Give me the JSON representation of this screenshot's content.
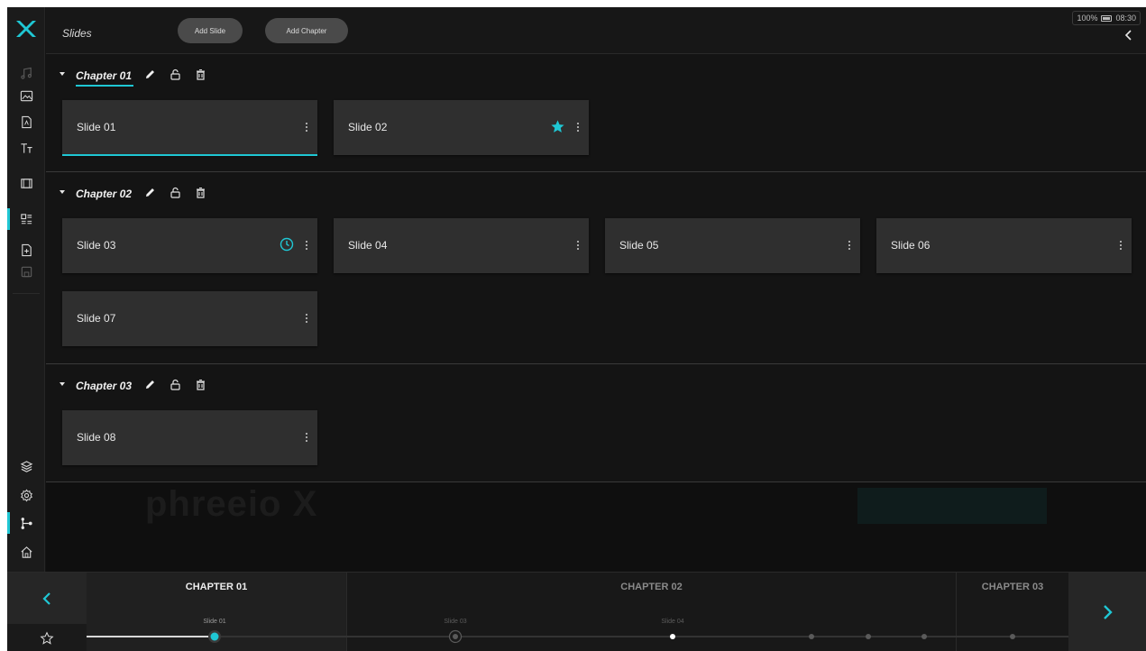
{
  "header": {
    "title": "Slides",
    "add_slide": "Add Slide",
    "add_chapter": "Add Chapter",
    "battery": "100%",
    "time": "08:30"
  },
  "rail": {
    "top_icons": [
      "music-icon",
      "image-icon",
      "pdf-icon",
      "text-icon",
      "video-icon",
      "slides-icon",
      "add-file-icon",
      "save-icon"
    ],
    "bottom_icons": [
      "layers-icon",
      "settings-icon",
      "flow-icon",
      "home-icon"
    ],
    "active": [
      "slides-icon",
      "flow-icon"
    ]
  },
  "chapters": [
    {
      "name": "Chapter 01",
      "slides": [
        {
          "label": "Slide 01",
          "selected": true
        },
        {
          "label": "Slide 02",
          "favorite": true
        }
      ]
    },
    {
      "name": "Chapter 02",
      "slides": [
        {
          "label": "Slide 03",
          "timed": true
        },
        {
          "label": "Slide 04"
        },
        {
          "label": "Slide 05"
        },
        {
          "label": "Slide 06"
        },
        {
          "label": "Slide 07"
        }
      ]
    },
    {
      "name": "Chapter 03",
      "slides": [
        {
          "label": "Slide 08"
        }
      ]
    }
  ],
  "timeline": {
    "chapters": [
      "CHAPTER 01",
      "CHAPTER 02",
      "CHAPTER 03"
    ],
    "markers": [
      "Slide 01",
      "Slide 03",
      "Slide 04"
    ]
  },
  "colors": {
    "accent": "#1fc7d4",
    "background": "#141414",
    "card": "#2f2f2f"
  }
}
